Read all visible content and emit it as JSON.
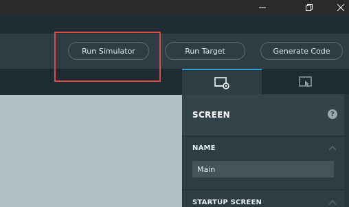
{
  "window": {
    "controls": {
      "minimize_icon": "minimize-icon",
      "maximize_icon": "restore-icon",
      "close_icon": "close-icon"
    }
  },
  "toolbar": {
    "run_simulator_label": "Run Simulator",
    "run_target_label": "Run Target",
    "generate_code_label": "Generate Code"
  },
  "panel": {
    "tabs": [
      {
        "icon": "screen-settings-icon",
        "active": true
      },
      {
        "icon": "interaction-icon",
        "active": false
      }
    ],
    "section_title": "SCREEN",
    "help_icon_label": "?",
    "name_label": "NAME",
    "name_value": "Main",
    "startup_label": "STARTUP SCREEN"
  },
  "colors": {
    "accent": "#2a9fd6",
    "highlight": "#e24740",
    "canvas": "#b3c1c5"
  }
}
